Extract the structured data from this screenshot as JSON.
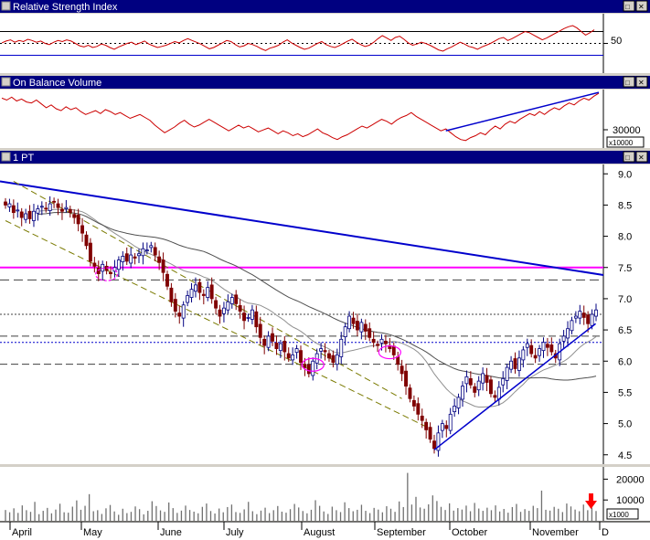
{
  "panels": {
    "rsi": {
      "title": "Relative Strength Index",
      "tick_label": "50",
      "level_upper": 70,
      "level_mid": 50,
      "level_lower": 30
    },
    "obv": {
      "title": "On Balance Volume",
      "tick_label": "30000",
      "unit_label": "x10000"
    },
    "price": {
      "title": "1 PT"
    },
    "volume": {
      "unit_label": "x1000"
    }
  },
  "window_buttons": [
    "□",
    "✕"
  ],
  "months": [
    "April",
    "May",
    "June",
    "July",
    "August",
    "September",
    "October",
    "November",
    "D"
  ],
  "colors": {
    "candle_up": "#ffffff",
    "candle_down": "#800000",
    "rsi_line": "#cc0000",
    "trend_blue": "#0000cc",
    "resistance": "#ff00ff",
    "channel": "#7a7a00",
    "ma_short": "#909090",
    "ma_long": "#505050",
    "arrow": "#ff0000"
  },
  "chart_data": [
    {
      "type": "line",
      "name": "rsi",
      "title": "Relative Strength Index",
      "ylim": [
        0,
        100
      ],
      "yticks": [
        50
      ],
      "reference_lines": [
        70,
        50,
        30
      ],
      "values": [
        51,
        54,
        56,
        52,
        55,
        53,
        57,
        55,
        52,
        54,
        50,
        48,
        52,
        55,
        53,
        56,
        54,
        50,
        46,
        44,
        47,
        43,
        45,
        49,
        47,
        43,
        40,
        44,
        47,
        50,
        52,
        48,
        51,
        54,
        49,
        46,
        43,
        45,
        47,
        50,
        53,
        51,
        55,
        58,
        55,
        52,
        49,
        45,
        41,
        43,
        47,
        51,
        55,
        53,
        48,
        44,
        46,
        50,
        48,
        45,
        41,
        38,
        42,
        44,
        47,
        52,
        56,
        51,
        47,
        43,
        40,
        42,
        46,
        50,
        53,
        48,
        45,
        43,
        46,
        50,
        54,
        57,
        52,
        48,
        45,
        47,
        52,
        58,
        63,
        59,
        55,
        60,
        62,
        57,
        51,
        47,
        49,
        52,
        50,
        47,
        43,
        39,
        37,
        41,
        44,
        48,
        52,
        49,
        45,
        43,
        40,
        44,
        47,
        50,
        54,
        58,
        60,
        55,
        58,
        62,
        66,
        70,
        68,
        64,
        60,
        56,
        59,
        63,
        67,
        71,
        75,
        78,
        80,
        76,
        70,
        64,
        68,
        73
      ],
      "grid": false
    },
    {
      "type": "line",
      "name": "on-balance-volume",
      "title": "On Balance Volume",
      "yunit": "x10000",
      "yticks": [
        30000
      ],
      "values": [
        58,
        56,
        59,
        55,
        57,
        54,
        53,
        56,
        52,
        48,
        51,
        47,
        45,
        49,
        46,
        48,
        44,
        41,
        43,
        45,
        42,
        46,
        44,
        41,
        43,
        40,
        37,
        39,
        41,
        38,
        35,
        30,
        26,
        22,
        25,
        28,
        32,
        35,
        31,
        28,
        30,
        33,
        36,
        33,
        30,
        27,
        24,
        27,
        30,
        27,
        29,
        26,
        23,
        25,
        27,
        24,
        21,
        24,
        22,
        19,
        21,
        18,
        20,
        23,
        26,
        22,
        20,
        17,
        15,
        18,
        20,
        23,
        26,
        29,
        27,
        30,
        33,
        36,
        34,
        31,
        35,
        38,
        40,
        43,
        39,
        36,
        33,
        30,
        27,
        24,
        26,
        22,
        18,
        15,
        14,
        17,
        19,
        22,
        20,
        25,
        29,
        26,
        31,
        34,
        32,
        36,
        39,
        42,
        40,
        44,
        41,
        45,
        48,
        46,
        50,
        53,
        51,
        55,
        58,
        56,
        60,
        63
      ],
      "trendline": {
        "from_index": 90,
        "to_index": 121
      },
      "grid": false
    },
    {
      "type": "candlestick",
      "name": "price",
      "title": "1 PT",
      "ylim": [
        4.35,
        9.15
      ],
      "yticks": [
        4.5,
        5.0,
        5.5,
        6.0,
        6.5,
        7.0,
        7.5,
        8.0,
        8.5,
        9.0
      ],
      "closes": [
        8.5,
        8.52,
        8.38,
        8.42,
        8.3,
        8.36,
        8.28,
        8.4,
        8.44,
        8.48,
        8.44,
        8.52,
        8.55,
        8.46,
        8.4,
        8.46,
        8.38,
        8.3,
        8.2,
        8.05,
        7.85,
        7.6,
        7.52,
        7.4,
        7.55,
        7.45,
        7.4,
        7.5,
        7.62,
        7.68,
        7.6,
        7.7,
        7.65,
        7.72,
        7.8,
        7.78,
        7.85,
        7.7,
        7.58,
        7.42,
        7.2,
        6.95,
        6.8,
        6.72,
        6.9,
        7.05,
        7.15,
        7.22,
        7.1,
        7.05,
        7.18,
        7.0,
        6.85,
        6.72,
        6.85,
        6.95,
        7.02,
        6.92,
        6.8,
        6.65,
        6.7,
        6.82,
        6.55,
        6.38,
        6.25,
        6.4,
        6.32,
        6.2,
        6.28,
        6.15,
        6.05,
        6.1,
        6.2,
        5.98,
        5.9,
        5.8,
        6.0,
        6.12,
        6.2,
        6.15,
        6.05,
        5.98,
        6.1,
        6.35,
        6.55,
        6.72,
        6.6,
        6.5,
        6.62,
        6.48,
        6.38,
        6.3,
        6.25,
        6.35,
        6.28,
        6.2,
        6.1,
        5.95,
        5.8,
        5.6,
        5.4,
        5.28,
        5.15,
        5.05,
        4.9,
        4.75,
        4.6,
        4.85,
        5.0,
        4.92,
        5.15,
        5.28,
        5.42,
        5.6,
        5.75,
        5.62,
        5.5,
        5.68,
        5.8,
        5.66,
        5.48,
        5.42,
        5.58,
        5.72,
        5.9,
        6.0,
        5.88,
        6.05,
        6.18,
        6.28,
        6.12,
        6.05,
        6.2,
        6.3,
        6.22,
        6.15,
        6.05,
        6.28,
        6.4,
        6.52,
        6.65,
        6.72,
        6.8,
        6.7,
        6.6,
        6.75,
        6.82
      ],
      "moving_averages": [
        {
          "name": "short",
          "closes_window": 20
        },
        {
          "name": "long",
          "closes_window": 50
        }
      ],
      "resistance_level": 7.5,
      "horizontal_levels": [
        7.3,
        6.75,
        6.4,
        6.3,
        5.95
      ],
      "long_trendline": {
        "from_value": 8.88,
        "to_value": 7.38
      },
      "uptrend_line": {
        "from_index": 106,
        "from_value": 4.58,
        "to_index": 145,
        "to_value": 6.6
      },
      "channel_lines": [
        {
          "from_index": 2,
          "from_value": 8.88,
          "to_index": 98,
          "to_value": 5.4
        },
        {
          "from_index": 0,
          "from_value": 8.25,
          "to_index": 104,
          "to_value": 4.95
        }
      ],
      "highlights": [
        25,
        76,
        95
      ],
      "grid": false
    },
    {
      "type": "bar",
      "name": "volume",
      "yunit": "x1000",
      "yticks": [
        10000,
        20000
      ],
      "ylim": [
        0,
        25000
      ],
      "values": [
        5200,
        4100,
        6000,
        3800,
        7400,
        5100,
        4300,
        9100,
        3200,
        4800,
        6200,
        3600,
        5400,
        8200,
        4100,
        3900,
        6800,
        9800,
        5300,
        7200,
        12800,
        4600,
        5100,
        3300,
        6000,
        7600,
        4500,
        2900,
        5800,
        3700,
        4300,
        6900,
        5600,
        3100,
        4800,
        9400,
        7100,
        5000,
        4300,
        8800,
        6100,
        3800,
        4900,
        7300,
        5200,
        4400,
        3600,
        6700,
        8300,
        4700,
        3500,
        5900,
        4100,
        6600,
        7800,
        4200,
        3800,
        5500,
        9100,
        4600,
        3200,
        4900,
        6300,
        3700,
        5100,
        7100,
        4400,
        3900,
        5600,
        8100,
        6400,
        4700,
        3600,
        5300,
        9900,
        7200,
        4500,
        3300,
        6800,
        5100,
        4200,
        8900,
        6100,
        4600,
        5300,
        7700,
        4800,
        3700,
        6200,
        5400,
        4100,
        7000,
        5800,
        4300,
        9300,
        6600,
        23000,
        7800,
        11500,
        6400,
        5800,
        7900,
        12200,
        9500,
        6700,
        5200,
        8400,
        4900,
        6100,
        5400,
        7300,
        4600,
        8600,
        5900,
        4800,
        6300,
        5100,
        7400,
        4500,
        5700,
        3900,
        6600,
        8100,
        4300,
        5600,
        4800,
        7200,
        6100,
        14500,
        5300,
        4900,
        6700,
        5800,
        4200,
        8300,
        6900,
        5400,
        4600,
        7800,
        5100,
        6300,
        4700
      ]
    }
  ],
  "annotation_arrow": "down-arrow-icon"
}
